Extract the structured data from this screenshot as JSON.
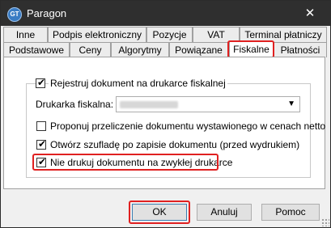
{
  "window": {
    "title": "Paragon",
    "app_icon_text": "GT",
    "close_glyph": "✕"
  },
  "tabs_row1": [
    {
      "label": "Inne"
    },
    {
      "label": "Podpis elektroniczny"
    },
    {
      "label": "Pozycje"
    },
    {
      "label": "VAT"
    },
    {
      "label": "Terminal płatniczy"
    }
  ],
  "tabs_row2": [
    {
      "label": "Podstawowe"
    },
    {
      "label": "Ceny"
    },
    {
      "label": "Algorytmy"
    },
    {
      "label": "Powiązane"
    },
    {
      "label": "Fiskalne",
      "active": true
    },
    {
      "label": "Płatności"
    }
  ],
  "fiscal": {
    "register_label": "Rejestruj dokument na drukarce fiskalnej",
    "register_checked": true,
    "printer_label": "Drukarka fiskalna:",
    "printer_value_hidden": true,
    "options": [
      {
        "label": "Proponuj przeliczenie dokumentu wystawionego w cenach netto",
        "checked": false
      },
      {
        "label": "Otwórz szufladę po zapisie dokumentu (przed wydrukiem)",
        "checked": true
      },
      {
        "label": "Nie drukuj dokumentu na zwykłej drukarce",
        "checked": true
      }
    ]
  },
  "buttons": {
    "ok": "OK",
    "cancel": "Anuluj",
    "help": "Pomoc"
  },
  "colors": {
    "highlight": "#e02020",
    "titlebar": "#2f2f2f"
  }
}
